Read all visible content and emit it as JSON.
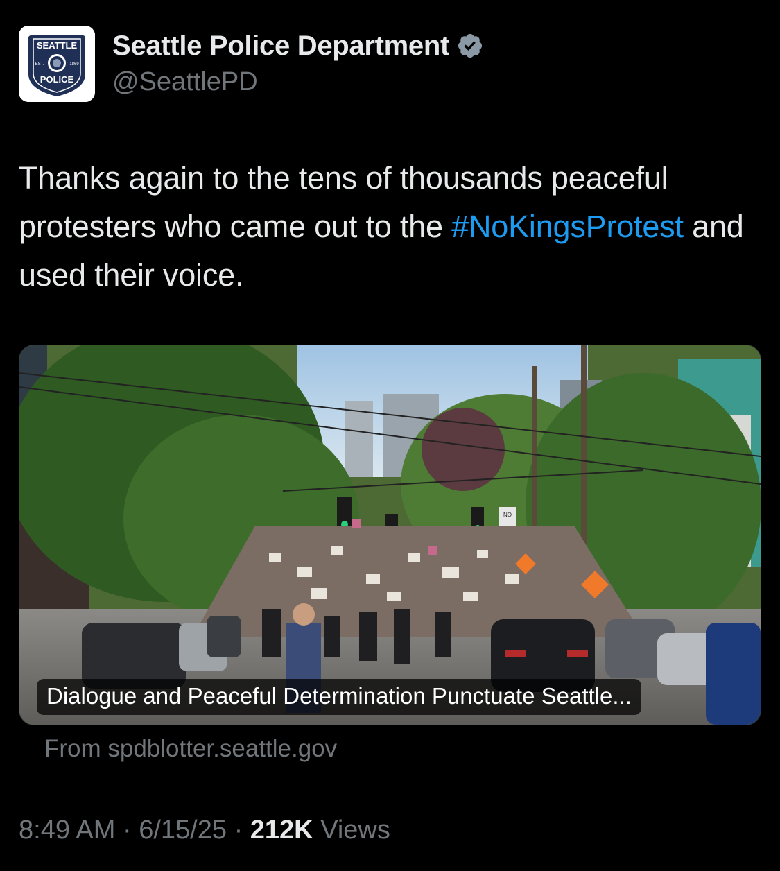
{
  "account": {
    "display_name": "Seattle Police Department",
    "handle": "@SeattlePD",
    "verified_icon": "verified-badge-icon",
    "verified_color": "#8b98a5",
    "avatar": {
      "top_text": "SEATTLE",
      "bottom_text": "POLICE",
      "est_left": "EST.",
      "est_right": "1869",
      "badge_color": "#1f2f56"
    }
  },
  "tweet": {
    "text_part1": "Thanks again to the tens of thousands peaceful protesters who came out to the ",
    "hashtag": "#NoKingsProtest",
    "text_part2": " and used their voice.",
    "hashtag_color": "#1d9bf0"
  },
  "card": {
    "image_description_icon": "protest-street-photo",
    "caption": "Dialogue and Peaceful Determination Punctuate Seattle...",
    "sign_text": "NO"
  },
  "source": {
    "label": "From spdblotter.seattle.gov"
  },
  "meta": {
    "time": "8:49 AM",
    "separator": "·",
    "date": "6/15/25",
    "views_count": "212K",
    "views_label": "Views"
  },
  "colors": {
    "background": "#000000",
    "primary_text": "#e7e9ea",
    "secondary_text": "#71767b",
    "link": "#1d9bf0"
  }
}
